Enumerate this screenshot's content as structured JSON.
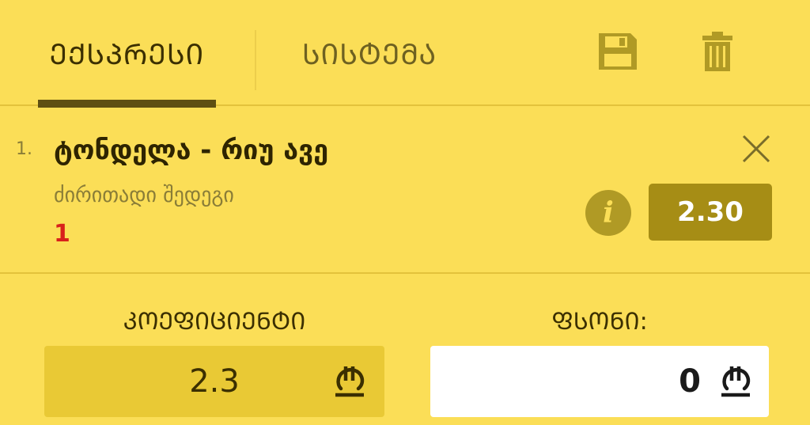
{
  "tabs": [
    {
      "label": "ᲔᲥᲡᲞᲠᲔᲡᲘ",
      "active": true
    },
    {
      "label": "ᲡᲘᲡᲢᲔᲛᲐ",
      "active": false
    }
  ],
  "toolbar": {
    "save_icon": "save-icon",
    "trash_icon": "trash-icon"
  },
  "bet": {
    "index": "1.",
    "title": "ტონდელა - რიუ ავე",
    "market": "ძირითადი შედეგი",
    "pick": "1",
    "odds": "2.30",
    "info": "i"
  },
  "summary": {
    "coef_label": "ᲙᲝᲔᲤᲘᲪᲘᲔᲜᲢᲘ",
    "coef_value": "2.3",
    "stake_label": "ᲤᲡᲝᲜᲘ:",
    "stake_value": "0",
    "currency_icon": "lari-icon"
  },
  "colors": {
    "background": "#fbde57",
    "accent_dark": "#5e4f12",
    "odds_badge": "#a68d15",
    "pick_red": "#d8211b"
  }
}
